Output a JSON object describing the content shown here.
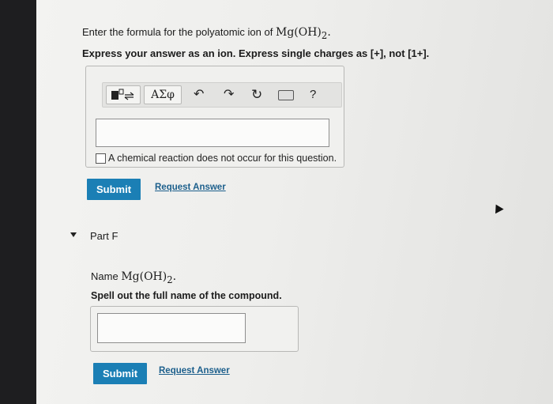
{
  "question": {
    "prompt_text": "Enter the formula for the polyatomic ion of",
    "formula": "Mg(OH)",
    "formula_sub": "2",
    "period": ".",
    "instruction": "Express your answer as an ion. Express single charges as [+], not [1+]."
  },
  "toolbar": {
    "templates_icon": "templates-icon",
    "symbols_label": "ΑΣφ",
    "undo_icon": "undo-icon",
    "redo_icon": "redo-icon",
    "reset_icon": "reset-icon",
    "keyboard_icon": "keyboard-icon",
    "help_label": "?"
  },
  "answer": {
    "value": ""
  },
  "no_reaction": {
    "label": "A chemical reaction does not occur for this question.",
    "checked": false
  },
  "part_e_actions": {
    "submit_label": "Submit",
    "request_label": "Request Answer"
  },
  "part_f": {
    "title": "Part F",
    "name_prefix": "Name",
    "formula": "Mg(OH)",
    "formula_sub": "2",
    "period": ".",
    "instruction": "Spell out the full name of the compound.",
    "answer_value": "",
    "submit_label": "Submit",
    "request_label": "Request Answer"
  },
  "colors": {
    "submit_bg": "#1b7fb5",
    "link": "#1c5f8c"
  }
}
